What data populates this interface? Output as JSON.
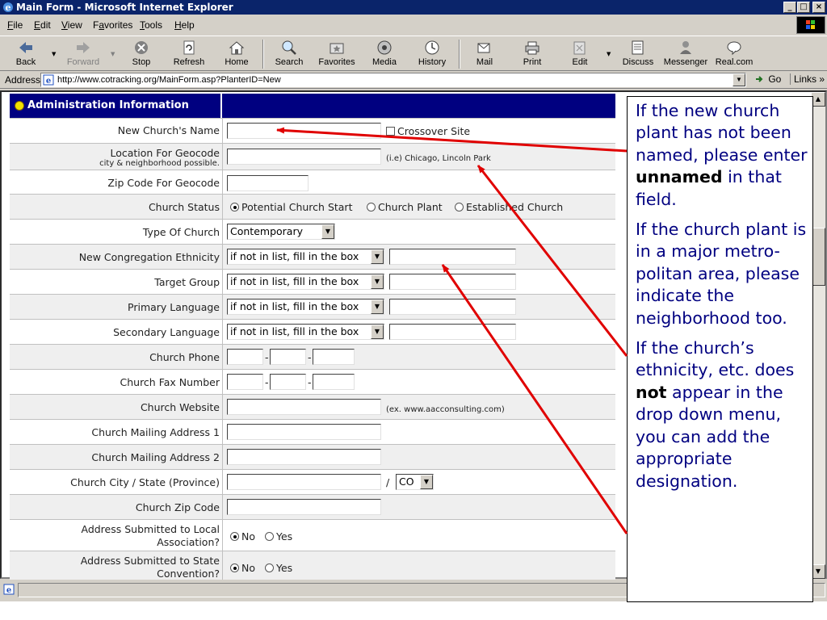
{
  "window": {
    "title": "Main Form - Microsoft Internet Explorer",
    "controls": [
      "_",
      "□",
      "×"
    ]
  },
  "menu": [
    {
      "label": "File",
      "key": "F"
    },
    {
      "label": "Edit",
      "key": "E"
    },
    {
      "label": "View",
      "key": "V"
    },
    {
      "label": "Favorites",
      "key": "a"
    },
    {
      "label": "Tools",
      "key": "T"
    },
    {
      "label": "Help",
      "key": "H"
    }
  ],
  "toolbar": {
    "back": "Back",
    "forward": "Forward",
    "stop": "Stop",
    "refresh": "Refresh",
    "home": "Home",
    "search": "Search",
    "favorites": "Favorites",
    "media": "Media",
    "history": "History",
    "mail": "Mail",
    "print": "Print",
    "edit": "Edit",
    "discuss": "Discuss",
    "messenger": "Messenger",
    "real": "Real.com"
  },
  "address": {
    "label": "Address",
    "url": "http://www.cotracking.org/MainForm.asp?PlanterID=New",
    "go": "Go",
    "links": "Links"
  },
  "form": {
    "section_title": "Administration Information",
    "rows": {
      "church_name": {
        "label": "New Church's Name",
        "checkbox": "Crossover Site"
      },
      "geocode": {
        "label": "Location For Geocode",
        "sublabel": "city & neighborhood possible.",
        "hint": "(i.e) Chicago, Lincoln Park"
      },
      "zip_geocode": {
        "label": "Zip Code For Geocode"
      },
      "status": {
        "label": "Church Status",
        "options": [
          "Potential Church Start",
          "Church Plant",
          "Established Church"
        ]
      },
      "type": {
        "label": "Type Of Church",
        "value": "Contemporary"
      },
      "ethnicity": {
        "label": "New Congregation Ethnicity",
        "value": "if not in list, fill in the box"
      },
      "target": {
        "label": "Target Group",
        "value": "if not in list, fill in the box"
      },
      "primary_lang": {
        "label": "Primary Language",
        "value": "if not in list, fill in the box"
      },
      "secondary_lang": {
        "label": "Secondary Language",
        "value": "if not in list, fill in the box"
      },
      "phone": {
        "label": "Church Phone"
      },
      "fax": {
        "label": "Church Fax Number"
      },
      "website": {
        "label": "Church Website",
        "hint": "(ex. www.aacconsulting.com)"
      },
      "mail1": {
        "label": "Church Mailing Address 1"
      },
      "mail2": {
        "label": "Church Mailing Address 2"
      },
      "city_state": {
        "label": "Church City / State (Province)",
        "state": "CO"
      },
      "zip": {
        "label": "Church Zip Code"
      },
      "local_assoc": {
        "label_line1": "Address Submitted to Local",
        "label_line2": "Association?",
        "no": "No",
        "yes": "Yes"
      },
      "state_conv": {
        "label_line1": "Address Submitted to State",
        "label_line2": "Convention?",
        "no": "No",
        "yes": "Yes"
      }
    }
  },
  "callout": {
    "p1_a": "If the new church plant has not been named, please enter",
    "p1_bold": "unnamed",
    "p1_b": "in that field.",
    "p2": "If the church plant is in a major metro-politan area, please indicate the neighborhood too.",
    "p3_a": "If the church’s ethnicity, etc. does",
    "p3_bold": "not",
    "p3_b": "appear in the drop down menu, you can add the appropriate designation."
  },
  "colors": {
    "titlebar": "#0a246a",
    "section_header": "#000080",
    "callout_text": "#000080",
    "arrow": "#e00000"
  }
}
